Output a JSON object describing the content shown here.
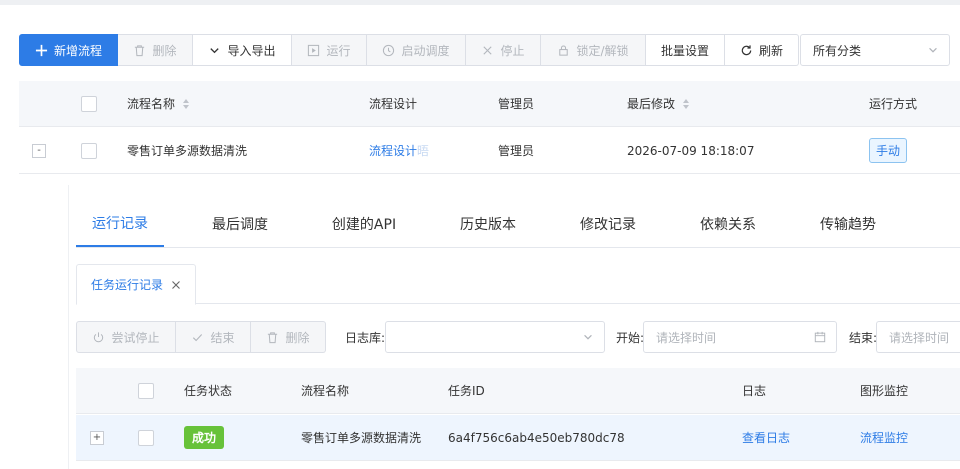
{
  "toolbar": {
    "add_label": "新增流程",
    "delete_label": "删除",
    "import_export_label": "导入导出",
    "run_label": "运行",
    "schedule_label": "启动调度",
    "stop_label": "停止",
    "lock_label": "锁定/解锁",
    "batch_label": "批量设置",
    "refresh_label": "刷新",
    "category_value": "所有分类"
  },
  "main_table": {
    "headers": [
      "流程名称",
      "流程设计",
      "管理员",
      "最后修改",
      "运行方式"
    ],
    "rows": [
      {
        "expand_symbol": "-",
        "name": "零售订单多源数据清洗",
        "design": "流程设计",
        "design_suffix": "晤",
        "admin": "管理员",
        "modified": "2026-07-09 18:18:07",
        "run_mode": "手动"
      }
    ]
  },
  "detail": {
    "tabs": [
      "运行记录",
      "最后调度",
      "创建的API",
      "历史版本",
      "修改记录",
      "依赖关系",
      "传输趋势"
    ],
    "active_tab": 0,
    "subtab_label": "任务运行记录",
    "subtoolbar": {
      "try_stop_label": "尝试停止",
      "finish_label": "结束",
      "delete_label": "删除",
      "log_db_label": "日志库:",
      "start_label": "开始:",
      "start_placeholder": "请选择时间",
      "end_label": "结束:",
      "end_placeholder": "请选择时间"
    },
    "task_table": {
      "headers": [
        "任务状态",
        "流程名称",
        "任务ID",
        "日志",
        "图形监控"
      ],
      "rows": [
        {
          "expand_symbol": "+",
          "status": "成功",
          "name": "零售订单多源数据清洗",
          "task_id": "6a4f756c6ab4e50eb780dc78",
          "log_link": "查看日志",
          "monitor_link": "流程监控"
        }
      ]
    }
  },
  "colors": {
    "primary": "#2d7ce6",
    "success": "#67c23a",
    "disabled_text": "#b3b7bd"
  }
}
